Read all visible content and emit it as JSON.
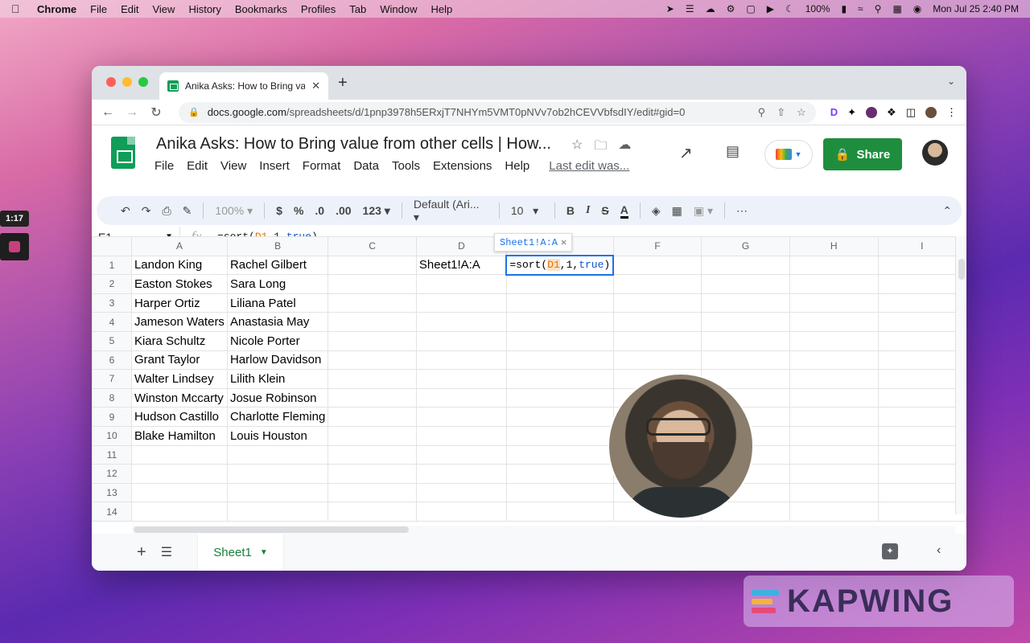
{
  "menubar": {
    "app": "Chrome",
    "items": [
      "File",
      "Edit",
      "View",
      "History",
      "Bookmarks",
      "Profiles",
      "Tab",
      "Window",
      "Help"
    ],
    "battery": "100%",
    "datetime": "Mon Jul 25  2:40 PM"
  },
  "recorder": {
    "time": "1:17"
  },
  "browser": {
    "tab_title": "Anika Asks: How to Bring value",
    "url_host": "docs.google.com",
    "url_path": "/spreadsheets/d/1pnp3978h5ERxjT7NHYm5VMT0pNVv7ob2hCEVVbfsdIY/edit#gid=0"
  },
  "doc": {
    "title": "Anika Asks: How to Bring value from other cells | How...",
    "menus": [
      "File",
      "Edit",
      "View",
      "Insert",
      "Format",
      "Data",
      "Tools",
      "Extensions",
      "Help"
    ],
    "last_edit": "Last edit was...",
    "share_label": "Share"
  },
  "format_toolbar": {
    "zoom": "100%",
    "currency": "$",
    "percent": "%",
    "dec_less": ".0",
    "dec_more": ".00",
    "more_formats": "123",
    "font": "Default (Ari...",
    "font_size": "10"
  },
  "formula_bar": {
    "cell": "E1",
    "fx": "fx",
    "prefix": "=sort(",
    "ref": "D1",
    "args": ",1,",
    "bool": "true",
    "suffix": ")"
  },
  "grid": {
    "columns": [
      "A",
      "B",
      "C",
      "D",
      "E",
      "F",
      "G",
      "H",
      "I"
    ],
    "rows": [
      {
        "n": "1",
        "a": "Landon King",
        "b": "Rachel Gilbert"
      },
      {
        "n": "2",
        "a": "Easton Stokes",
        "b": "Sara Long"
      },
      {
        "n": "3",
        "a": "Harper Ortiz",
        "b": "Liliana Patel"
      },
      {
        "n": "4",
        "a": "Jameson Waters",
        "b": "Anastasia May"
      },
      {
        "n": "5",
        "a": "Kiara Schultz",
        "b": "Nicole Porter"
      },
      {
        "n": "6",
        "a": "Grant Taylor",
        "b": "Harlow Davidson"
      },
      {
        "n": "7",
        "a": "Walter Lindsey",
        "b": "Lilith Klein"
      },
      {
        "n": "8",
        "a": "Winston Mccarty",
        "b": "Josue Robinson"
      },
      {
        "n": "9",
        "a": "Hudson Castillo",
        "b": "Charlotte Fleming"
      },
      {
        "n": "10",
        "a": "Blake Hamilton",
        "b": "Louis Houston"
      },
      {
        "n": "11",
        "a": "",
        "b": ""
      },
      {
        "n": "12",
        "a": "",
        "b": ""
      },
      {
        "n": "13",
        "a": "",
        "b": ""
      },
      {
        "n": "14",
        "a": "",
        "b": ""
      }
    ],
    "d1": "Sheet1!A:A",
    "e1_prefix": "=sort(",
    "e1_ref": "D1",
    "e1_args": ",1,",
    "e1_bool": "true",
    "e1_suffix": ")",
    "hint": "Sheet1!A:A"
  },
  "sheet_tabs": {
    "active": "Sheet1"
  },
  "watermark": {
    "text": "KAPWING"
  }
}
